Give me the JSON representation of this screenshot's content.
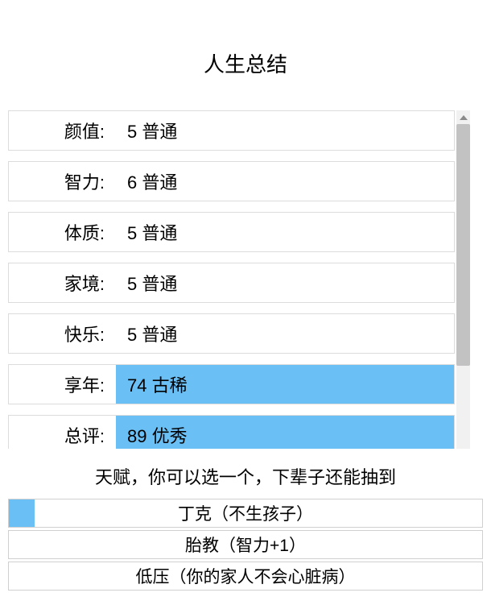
{
  "title": "人生总结",
  "stats": [
    {
      "label": "颜值:",
      "value": "5 普通",
      "highlight": false
    },
    {
      "label": "智力:",
      "value": "6 普通",
      "highlight": false
    },
    {
      "label": "体质:",
      "value": "5 普通",
      "highlight": false
    },
    {
      "label": "家境:",
      "value": "5 普通",
      "highlight": false
    },
    {
      "label": "快乐:",
      "value": "5 普通",
      "highlight": false
    },
    {
      "label": "享年:",
      "value": "74 古稀",
      "highlight": true
    },
    {
      "label": "总评:",
      "value": "89 优秀",
      "highlight": true
    }
  ],
  "talent_heading": "天赋，你可以选一个，下辈子还能抽到",
  "talents": [
    {
      "text": "丁克（不生孩子）",
      "selected": true
    },
    {
      "text": "胎教（智力+1）",
      "selected": false
    },
    {
      "text": "低压（你的家人不会心脏病）",
      "selected": false
    }
  ]
}
